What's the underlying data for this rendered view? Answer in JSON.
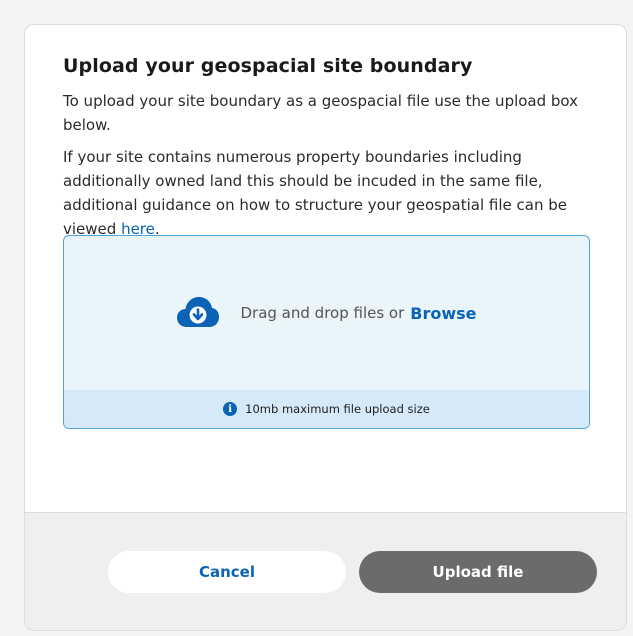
{
  "modal": {
    "title": "Upload your geospacial site boundary",
    "intro": "To upload your site boundary as a geospacial file use the upload box below.",
    "guidance_text": "If your site contains numerous property boundaries including additionally owned land this should be incuded in the same file, additional guidance on how to structure your geospatial file can be viewed ",
    "guidance_link": "here",
    "guidance_end": "."
  },
  "dropzone": {
    "icon": "cloud-download-icon",
    "text": "Drag and drop files or",
    "browse_label": "Browse",
    "info_icon": "info-icon",
    "info_text": "10mb maximum file upload size"
  },
  "footer": {
    "cancel_label": "Cancel",
    "upload_label": "Upload file"
  },
  "colors": {
    "accent": "#0a63b4",
    "dropzone_bg": "#eaf4fb",
    "dropzone_border": "#4ea4e0",
    "upload_button_bg": "#6b6b6b"
  }
}
